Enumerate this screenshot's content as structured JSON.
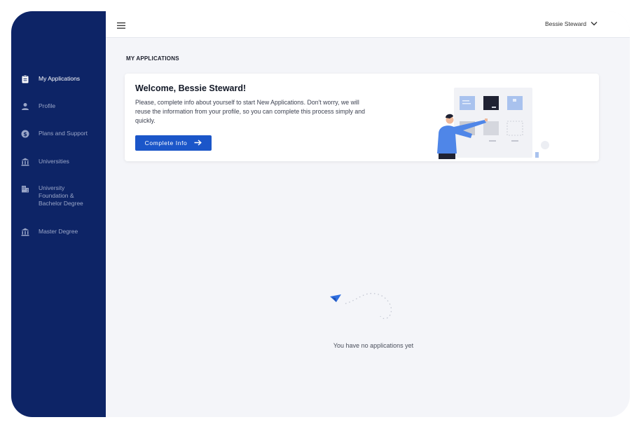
{
  "sidebar": {
    "items": [
      {
        "label": "My Applications",
        "icon": "clipboard-icon",
        "active": true
      },
      {
        "label": "Profile",
        "icon": "person-icon",
        "active": false
      },
      {
        "label": "Plans and Support",
        "icon": "dollar-icon",
        "active": false
      },
      {
        "label": "Universities",
        "icon": "bank-icon",
        "active": false
      },
      {
        "label": "University Foundation & Bachelor Degree",
        "icon": "building-icon",
        "active": false
      },
      {
        "label": "Master Degree",
        "icon": "bank-icon",
        "active": false
      }
    ]
  },
  "header": {
    "menu_icon": "hamburger-icon",
    "user_name": "Bessie Steward",
    "user_menu_icon": "chevron-down-icon"
  },
  "main": {
    "title": "MY APPLICATIONS",
    "welcome": {
      "title": "Welcome, Bessie Steward!",
      "text": "Please, complete info about yourself to start New Applications. Don't worry, we will reuse the information from your profile, so you can complete this process simply and quickly.",
      "button_label": "Complete Info",
      "button_icon": "arrow-right-icon"
    },
    "empty_state": {
      "icon": "paper-plane-icon",
      "text": "You have no applications yet"
    }
  },
  "colors": {
    "sidebar_bg": "#0d2466",
    "accent": "#1b56c9",
    "page_bg": "#f4f5f9"
  }
}
